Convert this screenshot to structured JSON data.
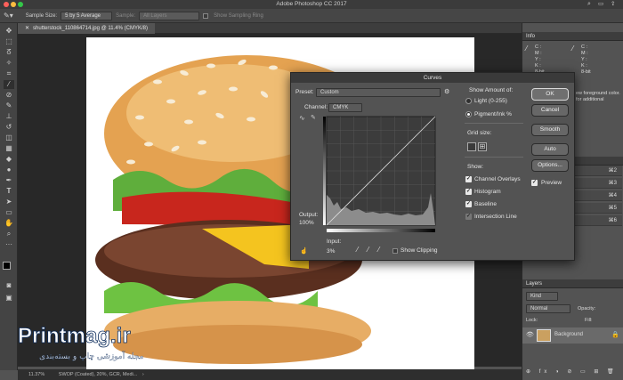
{
  "window": {
    "title": "Adobe Photoshop CC 2017"
  },
  "options_bar": {
    "sample_size_label": "Sample Size:",
    "sample_size_value": "5 by 5 Average",
    "sample_label": "Sample:",
    "sample_value": "All Layers",
    "show_ring_label": "Show Sampling Ring"
  },
  "document": {
    "tab_label": "shutterstock_110864714.jpg @ 11.4% (CMYK/8)",
    "zoom": "11.37%",
    "status": "SWOP (Coated), 20%, GCR, Medi..."
  },
  "curves": {
    "title": "Curves",
    "preset_label": "Preset:",
    "preset_value": "Custom",
    "channel_label": "Channel:",
    "channel_value": "CMYK",
    "output_label": "Output:",
    "output_value": "100%",
    "input_label": "Input:",
    "input_value": "3%",
    "show_clipping_label": "Show Clipping",
    "show_amount_label": "Show Amount of:",
    "light_label": "Light  (0-255)",
    "pigment_label": "Pigment/Ink %",
    "grid_size_label": "Grid size:",
    "show_label": "Show:",
    "channel_overlays_label": "Channel Overlays",
    "histogram_label": "Histogram",
    "baseline_label": "Baseline",
    "intersection_label": "Intersection Line",
    "buttons": {
      "ok": "OK",
      "cancel": "Cancel",
      "smooth": "Smooth",
      "auto": "Auto",
      "options": "Options..."
    },
    "preview_label": "Preview"
  },
  "info_panel": {
    "title": "Info",
    "cmyk_labels": [
      "C :",
      "M :",
      "Y :",
      "K :"
    ],
    "bit_label": "8-bit",
    "hint_line1": "ew foreground color.",
    "hint_line2": "for additional"
  },
  "actions_panel": {
    "shortcuts": [
      "⌘2",
      "⌘3",
      "⌘4",
      "⌘5",
      "⌘6"
    ]
  },
  "layers_panel": {
    "title": "Layers",
    "kind_label": "Kind",
    "blend_mode": "Normal",
    "opacity_label": "Opacity:",
    "lock_label": "Lock:",
    "fill_label": "Fill:",
    "layer_name": "Background"
  },
  "watermark": {
    "brand": "Printmag.ir",
    "tagline": "مجله آموزشی چاپ و بسته‌بندی"
  },
  "colors": {
    "accent": "#2b6fd6",
    "panel": "#535353",
    "dark": "#282828"
  }
}
